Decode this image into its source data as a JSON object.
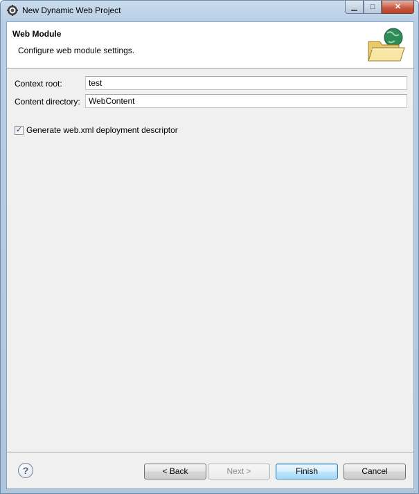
{
  "window": {
    "title": "New Dynamic Web Project",
    "controls": {
      "minimize_icon": "minimize-icon",
      "maximize_icon": "maximize-icon",
      "close_icon": "close-icon"
    }
  },
  "header": {
    "title": "Web Module",
    "description": "Configure web module settings.",
    "image_icon": "folder-globe-icon"
  },
  "form": {
    "context_root": {
      "label": "Context root:",
      "value": "test"
    },
    "content_directory": {
      "label": "Content directory:",
      "value": "WebContent"
    },
    "generate_descriptor": {
      "label": "Generate web.xml deployment descriptor",
      "checked": true
    }
  },
  "footer": {
    "help_icon": "help-icon",
    "back_label": "< Back",
    "next_label": "Next >",
    "finish_label": "Finish",
    "cancel_label": "Cancel"
  },
  "colors": {
    "accent": "#3c7fb1",
    "close_button": "#c8573f"
  }
}
